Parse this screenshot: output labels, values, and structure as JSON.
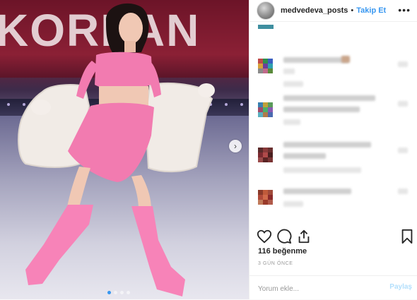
{
  "photo": {
    "banner_text": "KOREAN",
    "next_arrow": "chevron-right-icon",
    "slides_count": 4,
    "active_slide": 1
  },
  "header": {
    "username": "medvedeva_posts",
    "separator": "•",
    "follow_label": "Takip Et",
    "more_icon": "more-options-icon"
  },
  "actions": {
    "like_icon": "heart-icon",
    "comment_icon": "comment-bubble-icon",
    "share_icon": "share-icon",
    "save_icon": "bookmark-icon"
  },
  "likes": "116 beğenme",
  "timestamp": "3 GÜN ÖNCE",
  "comment_box": {
    "placeholder": "Yorum ekle...",
    "post_label": "Paylaş"
  },
  "colors": {
    "accent": "#3897f0",
    "post_disabled": "#b2dffc",
    "outfit_pink": "#f27bb0"
  }
}
